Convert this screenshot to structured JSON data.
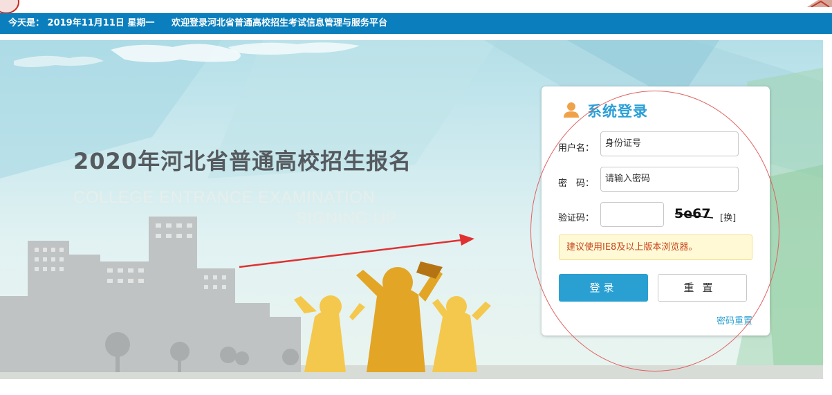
{
  "infobar": {
    "date": "今天是： 2019年11月11日 星期一",
    "welcome": "欢迎登录河北省普通高校招生考试信息管理与服务平台"
  },
  "banner": {
    "headline": "2020年河北省普通高校招生报名",
    "sub_line1": "COLLEGE ENTRANCE EXAMINATION",
    "sub_line2": "SIGNING UP"
  },
  "login": {
    "title": "系统登录",
    "username_label": "用户名：",
    "username_placeholder": "身份证号",
    "password_label": "密　码：",
    "password_placeholder": "请输入密码",
    "captcha_label": "验证码：",
    "captcha_value": "",
    "captcha_image_text": "5e67",
    "change_label": "[换]",
    "notice": "建议使用IE8及以上版本浏览器。",
    "login_button": "登录",
    "reset_button": "重置",
    "forgot_link": "密码重置"
  },
  "colors": {
    "infobar": "#0b7fbd",
    "accent": "#2aa0d2",
    "title": "#2a9fd8",
    "notice_text": "#c8461c",
    "annotation": "#e03030"
  },
  "icons": [
    "user-icon",
    "logo-left",
    "logo-right"
  ]
}
